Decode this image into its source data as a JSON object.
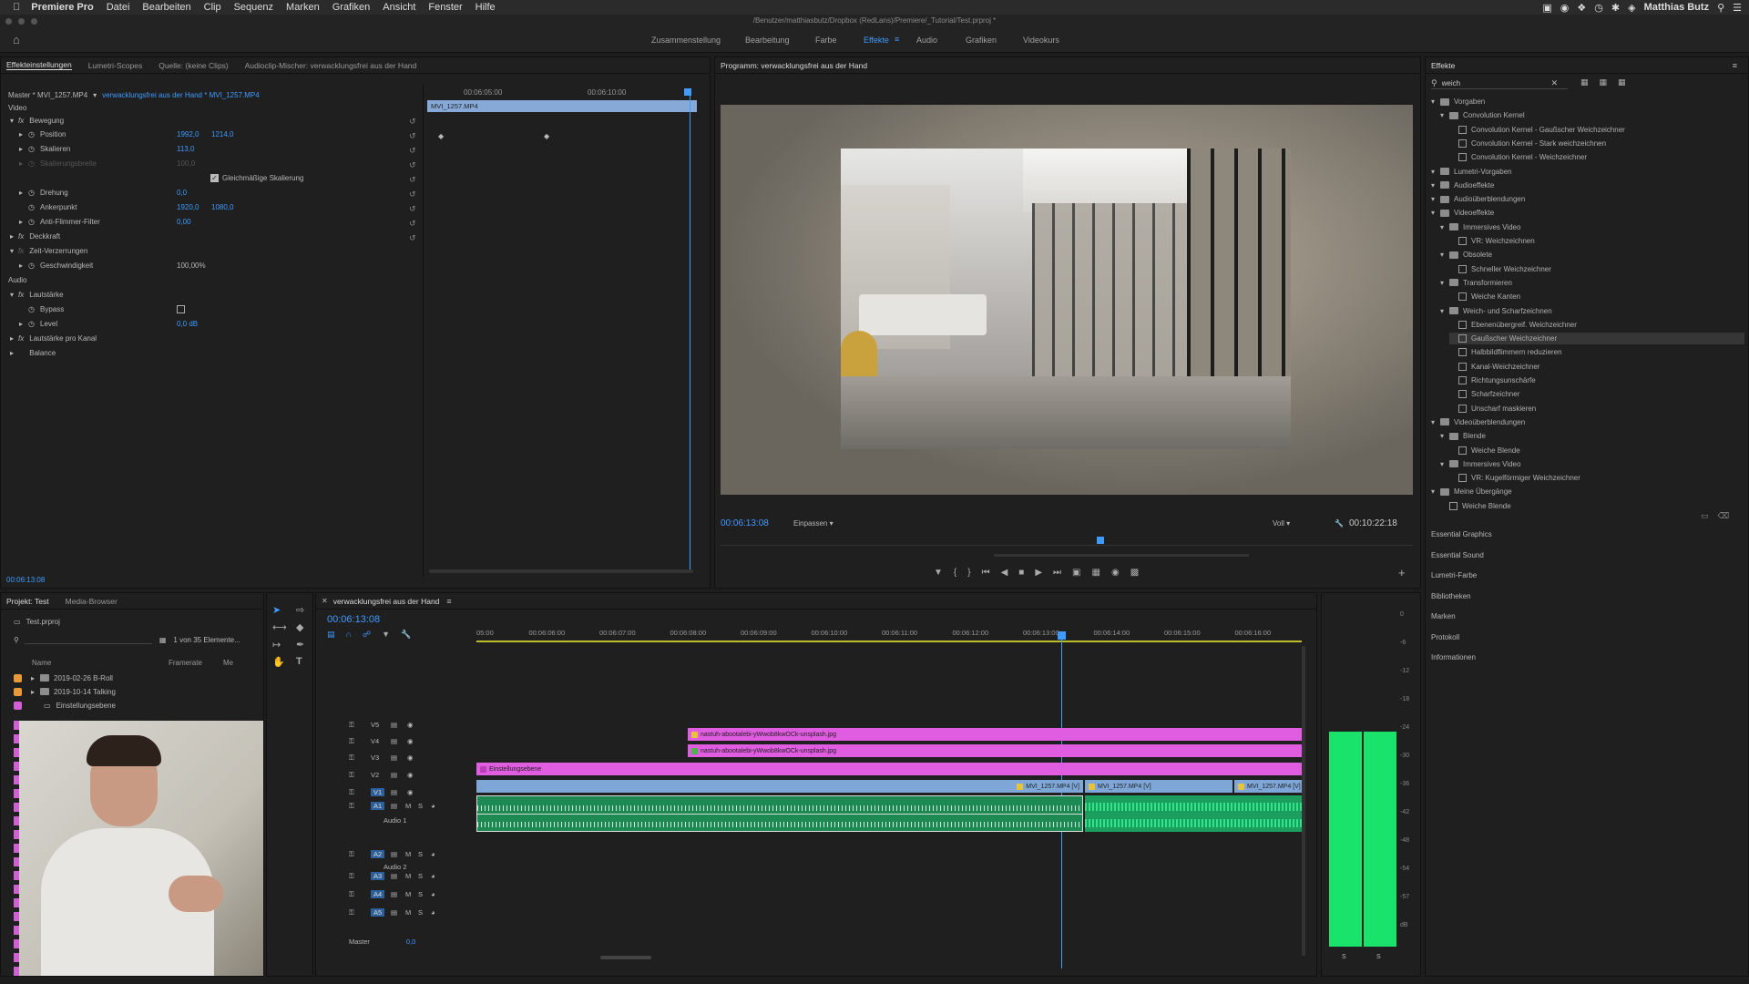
{
  "menubar": {
    "app_name": "Premiere Pro",
    "items": [
      "Datei",
      "Bearbeiten",
      "Clip",
      "Sequenz",
      "Marken",
      "Grafiken",
      "Ansicht",
      "Fenster",
      "Hilfe"
    ],
    "user": "Matthias Butz"
  },
  "window_title": "/Benutzer/matthiasbutz/Dropbox (RedLans)/Premiere/_Tutorial/Test.prproj *",
  "workspaces": {
    "items": [
      "Zusammenstellung",
      "Bearbeitung",
      "Farbe",
      "Effekte",
      "Audio",
      "Grafiken",
      "Videokurs"
    ],
    "active": "Effekte"
  },
  "effect_controls": {
    "tabs": [
      "Effekteinstellungen",
      "Lumetri-Scopes",
      "Quelle: (keine Clips)",
      "Audioclip-Mischer: verwacklungsfrei aus der Hand"
    ],
    "master_label": "Master * MVI_1257.MP4",
    "sequence_clip_label": "verwacklungsfrei aus der Hand * MVI_1257.MP4",
    "timecode_marks": [
      "00:06:05:00",
      "00:06:10:00"
    ],
    "clip_name": "MVI_1257.MP4",
    "section_video": "Video",
    "section_audio": "Audio",
    "rows": [
      {
        "label": "Bewegung",
        "value": "",
        "value2": ""
      },
      {
        "label": "Position",
        "value": "1992,0",
        "value2": "1214,0"
      },
      {
        "label": "Skalieren",
        "value": "113,0",
        "value2": ""
      },
      {
        "label": "Skalierungsbreite",
        "value": "100,0",
        "value2": ""
      },
      {
        "label": "Gleichmäßige Skalierung",
        "value": "",
        "value2": ""
      },
      {
        "label": "Drehung",
        "value": "0,0",
        "value2": ""
      },
      {
        "label": "Ankerpunkt",
        "value": "1920,0",
        "value2": "1080,0"
      },
      {
        "label": "Anti-Flimmer-Filter",
        "value": "0,00",
        "value2": ""
      },
      {
        "label": "Deckkraft",
        "value": "",
        "value2": ""
      },
      {
        "label": "Zeit-Verzerrungen",
        "value": "",
        "value2": ""
      },
      {
        "label": "Geschwindigkeit",
        "value": "100,00%",
        "value2": ""
      }
    ],
    "audio_rows": [
      {
        "label": "Lautstärke",
        "value": ""
      },
      {
        "label": "Bypass",
        "value": ""
      },
      {
        "label": "Level",
        "value": "0,0 dB"
      },
      {
        "label": "Lautstärke pro Kanal",
        "value": ""
      },
      {
        "label": "Balance",
        "value": ""
      }
    ],
    "bottom_timecode": "00:06:13:08"
  },
  "program_monitor": {
    "title": "Programm: verwacklungsfrei aus der Hand",
    "timecode": "00:06:13:08",
    "fit": "Einpassen",
    "quality": "Voll",
    "duration": "00:10:22:18"
  },
  "effects_panel": {
    "title": "Effekte",
    "search_value": "weich",
    "tree": [
      {
        "level": 0,
        "type": "folder",
        "label": "Vorgaben"
      },
      {
        "level": 1,
        "type": "folder",
        "label": "Convolution Kernel"
      },
      {
        "level": 2,
        "type": "fx",
        "label": "Convolution Kernel - Gaußscher Weichzeichner"
      },
      {
        "level": 2,
        "type": "fx",
        "label": "Convolution Kernel - Stark weichzeichnen"
      },
      {
        "level": 2,
        "type": "fx",
        "label": "Convolution Kernel - Weichzeichner"
      },
      {
        "level": 0,
        "type": "folder",
        "label": "Lumetri-Vorgaben"
      },
      {
        "level": 0,
        "type": "folder",
        "label": "Audioeffekte"
      },
      {
        "level": 0,
        "type": "folder",
        "label": "Audioüberblendungen"
      },
      {
        "level": 0,
        "type": "folder",
        "label": "Videoeffekte"
      },
      {
        "level": 1,
        "type": "folder",
        "label": "Immersives Video"
      },
      {
        "level": 2,
        "type": "fx",
        "label": "VR: Weichzeichnen"
      },
      {
        "level": 1,
        "type": "folder",
        "label": "Obsolete"
      },
      {
        "level": 2,
        "type": "fx",
        "label": "Schneller Weichzeichner"
      },
      {
        "level": 1,
        "type": "folder",
        "label": "Transformieren"
      },
      {
        "level": 2,
        "type": "fx",
        "label": "Weiche Kanten"
      },
      {
        "level": 1,
        "type": "folder",
        "label": "Weich- und Scharfzeichnen"
      },
      {
        "level": 2,
        "type": "fx",
        "label": "Ebenenübergreif. Weichzeichner"
      },
      {
        "level": 2,
        "type": "fx",
        "label": "Gaußscher Weichzeichner"
      },
      {
        "level": 2,
        "type": "fx",
        "label": "Halbbildflimmern reduzieren"
      },
      {
        "level": 2,
        "type": "fx",
        "label": "Kanal-Weichzeichner"
      },
      {
        "level": 2,
        "type": "fx",
        "label": "Richtungsunschärfe"
      },
      {
        "level": 2,
        "type": "fx",
        "label": "Scharfzeichner"
      },
      {
        "level": 2,
        "type": "fx",
        "label": "Unscharf maskieren"
      },
      {
        "level": 0,
        "type": "folder",
        "label": "Videoüberblendungen"
      },
      {
        "level": 1,
        "type": "folder",
        "label": "Blende"
      },
      {
        "level": 2,
        "type": "fx",
        "label": "Weiche Blende"
      },
      {
        "level": 1,
        "type": "folder",
        "label": "Immersives Video"
      },
      {
        "level": 2,
        "type": "fx",
        "label": "VR: Kugelförmiger Weichzeichner"
      },
      {
        "level": 0,
        "type": "folder",
        "label": "Meine Übergänge"
      },
      {
        "level": 1,
        "type": "fx",
        "label": "Weiche Blende"
      }
    ],
    "selected": "Gaußscher Weichzeichner",
    "sections": [
      "Essential Graphics",
      "Essential Sound",
      "Lumetri-Farbe",
      "Bibliotheken",
      "Marken",
      "Protokoll",
      "Informationen"
    ]
  },
  "project_panel": {
    "tabs": [
      "Projekt: Test",
      "Media-Browser"
    ],
    "file": "Test.prproj",
    "count": "1 von 35 Elemente...",
    "columns": [
      "Name",
      "Framerate",
      "Me"
    ],
    "items": [
      {
        "label": "2019-02-26 B-Roll",
        "color": "#e8993a"
      },
      {
        "label": "2019-10-14 Talking",
        "color": "#e8993a"
      },
      {
        "label": "Einstellungsebene",
        "color": "#d35fd6"
      }
    ]
  },
  "timeline": {
    "title": "verwacklungsfrei aus der Hand",
    "timecode": "00:06:13:08",
    "ruler": [
      "05:00",
      "00:06:06:00",
      "00:06:07:00",
      "00:06:08:00",
      "00:06:09:00",
      "00:06:10:00",
      "00:06:11:00",
      "00:06:12:00",
      "00:06:13:00",
      "00:06:14:00",
      "00:06:15:00",
      "00:06:16:00"
    ],
    "video_tracks": [
      "V5",
      "V4",
      "V3",
      "V2",
      "V1"
    ],
    "audio_tracks": [
      "A1",
      "A2",
      "A3",
      "A4",
      "A5"
    ],
    "audio1_name": "Audio 1",
    "audio2_name": "Audio 2",
    "master_label": "Master",
    "master_value": "0,0",
    "clips": {
      "v5": "nastuh-abootalebi-yWwob8kwOCk-unsplash.jpg",
      "v4": "nastuh-abootalebi-yWwob8kwOCk-unsplash.jpg",
      "v3": "Einstellungsebene",
      "v1a": "MVI_1257.MP4 [V]",
      "v1b": "MVI_1257.MP4 [V]",
      "v1c": "MVI_1257.MP4 [V]"
    }
  },
  "meter": {
    "ticks": [
      "0",
      "-6",
      "-12",
      "-18",
      "-24",
      "-30",
      "-36",
      "-42",
      "-48",
      "-54",
      "-57",
      "dB"
    ],
    "channels": [
      "S",
      "S"
    ]
  },
  "colors": {
    "accent_blue": "#3f9bff",
    "clip_pink": "#e05ce0",
    "clip_blue": "#7ea7d8",
    "audio_green": "#1c8a52",
    "meter_green": "#19e36a"
  }
}
